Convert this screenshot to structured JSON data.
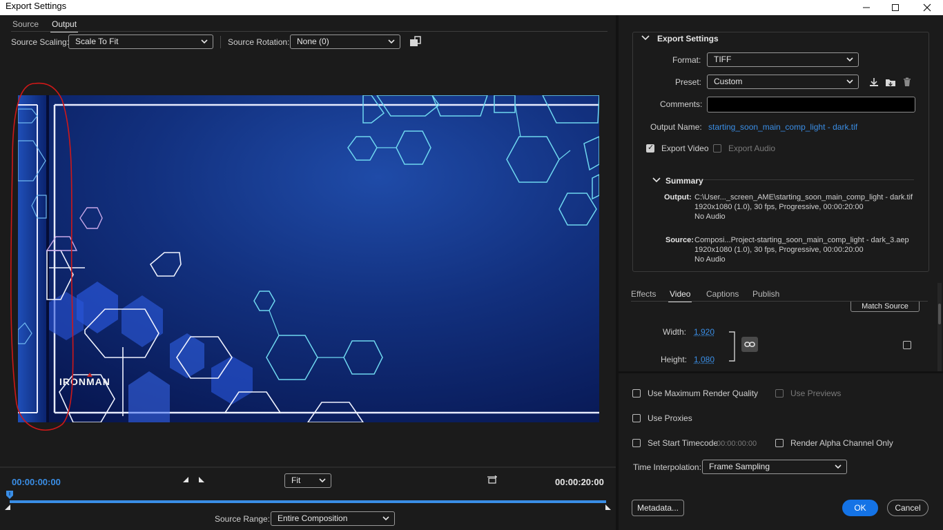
{
  "window": {
    "title": "Export Settings",
    "controls": [
      "minimize-icon",
      "maximize-icon",
      "close-icon"
    ]
  },
  "left": {
    "tabs": [
      {
        "label": "Source",
        "active": false
      },
      {
        "label": "Output",
        "active": true
      }
    ],
    "source_scaling_label": "Source Scaling:",
    "source_scaling_value": "Scale To Fit",
    "source_rotation_label": "Source Rotation:",
    "source_rotation_value": "None (0)",
    "preview_logo_text": "IRONMAN",
    "timeline": {
      "current_time": "00:00:00:00",
      "end_time": "00:00:20:00",
      "zoom_value": "Fit",
      "source_range_label": "Source Range:",
      "source_range_value": "Entire Composition",
      "playhead_position": 0
    }
  },
  "right": {
    "export_settings_title": "Export Settings",
    "format_label": "Format:",
    "format_value": "TIFF",
    "preset_label": "Preset:",
    "preset_value": "Custom",
    "comments_label": "Comments:",
    "comments_value": "",
    "output_name_label": "Output Name:",
    "output_name_value": "starting_soon_main_comp_light - dark.tif",
    "export_video_label": "Export Video",
    "export_video_checked": true,
    "export_audio_label": "Export Audio",
    "export_audio_checked": false,
    "summary": {
      "title": "Summary",
      "output_label": "Output:",
      "output_lines": [
        "C:\\User..._screen_AME\\starting_soon_main_comp_light - dark.tif",
        "1920x1080 (1.0), 30 fps, Progressive, 00:00:20:00",
        "No Audio"
      ],
      "source_label": "Source:",
      "source_lines": [
        "Composi...Project-starting_soon_main_comp_light - dark_3.aep",
        "1920x1080 (1.0), 30 fps, Progressive, 00:00:20:00",
        "No Audio"
      ]
    },
    "tabs": [
      {
        "label": "Effects",
        "active": false
      },
      {
        "label": "Video",
        "active": true
      },
      {
        "label": "Captions",
        "active": false
      },
      {
        "label": "Publish",
        "active": false
      }
    ],
    "match_source_label": "Match Source",
    "width_label": "Width:",
    "width_value": "1,920",
    "height_label": "Height:",
    "height_value": "1,080",
    "options": {
      "max_render_quality": "Use Maximum Render Quality",
      "use_previews": "Use Previews",
      "use_proxies": "Use Proxies",
      "set_start_timecode": "Set Start Timecode",
      "start_timecode_value": "00:00:00:00",
      "render_alpha": "Render Alpha Channel Only"
    },
    "time_interpolation_label": "Time Interpolation:",
    "time_interpolation_value": "Frame Sampling",
    "metadata_button": "Metadata...",
    "ok_button": "OK",
    "cancel_button": "Cancel"
  },
  "colors": {
    "accent": "#1473e6",
    "link": "#3a8ee6",
    "background": "#1b1b1b",
    "annotation": "#d01818"
  }
}
